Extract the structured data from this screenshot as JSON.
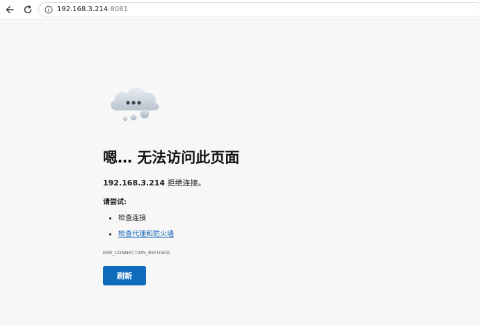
{
  "browser": {
    "url_host": "192.168.3.214",
    "url_port": ":8081"
  },
  "error_page": {
    "heading": "嗯… 无法访问此页面",
    "host": "192.168.3.214",
    "message": " 拒绝连接。",
    "try_label": "请尝试:",
    "suggestions": [
      {
        "label": "检查连接",
        "is_link": false
      },
      {
        "label": "检查代理和防火墙",
        "is_link": true
      }
    ],
    "error_code": "ERR_CONNECTION_REFUSED",
    "refresh_label": "刷新"
  },
  "icons": {
    "back": "back-arrow-icon",
    "reload": "reload-icon",
    "info": "info-icon",
    "cloud": "sad-cloud-icon"
  },
  "colors": {
    "accent": "#0f6cbd",
    "link": "#0f5fb8",
    "page_bg": "#f7f7f7"
  }
}
